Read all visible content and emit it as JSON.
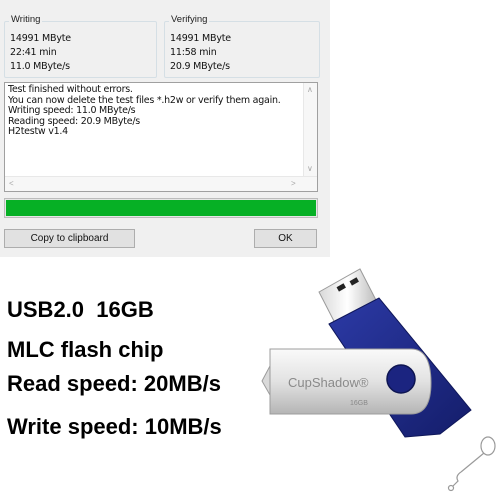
{
  "dialog": {
    "title_fragment": "~",
    "writing": {
      "legend": "Writing",
      "size": "14991 MByte",
      "time": "22:41 min",
      "speed": "11.0 MByte/s"
    },
    "verifying": {
      "legend": "Verifying",
      "size": "14991 MByte",
      "time": "11:58 min",
      "speed": "20.9 MByte/s"
    },
    "log_lines": [
      "Test finished without errors.",
      "You can now delete the test files *.h2w or verify them again.",
      "Writing speed: 11.0 MByte/s",
      "Reading speed: 20.9 MByte/s",
      "H2testw v1.4"
    ],
    "progress_fraction": 1.0,
    "progress_color": "#06b025",
    "copy_button": "Copy to clipboard",
    "ok_button": "OK"
  },
  "product": {
    "specs": [
      "USB2.0  16GB",
      "MLC flash chip",
      "Read speed: 20MB/s",
      "Write speed: 10MB/s"
    ],
    "brand": "CupShadow®",
    "capacity_label": "16GB",
    "body_color": "#1f2c8c"
  }
}
